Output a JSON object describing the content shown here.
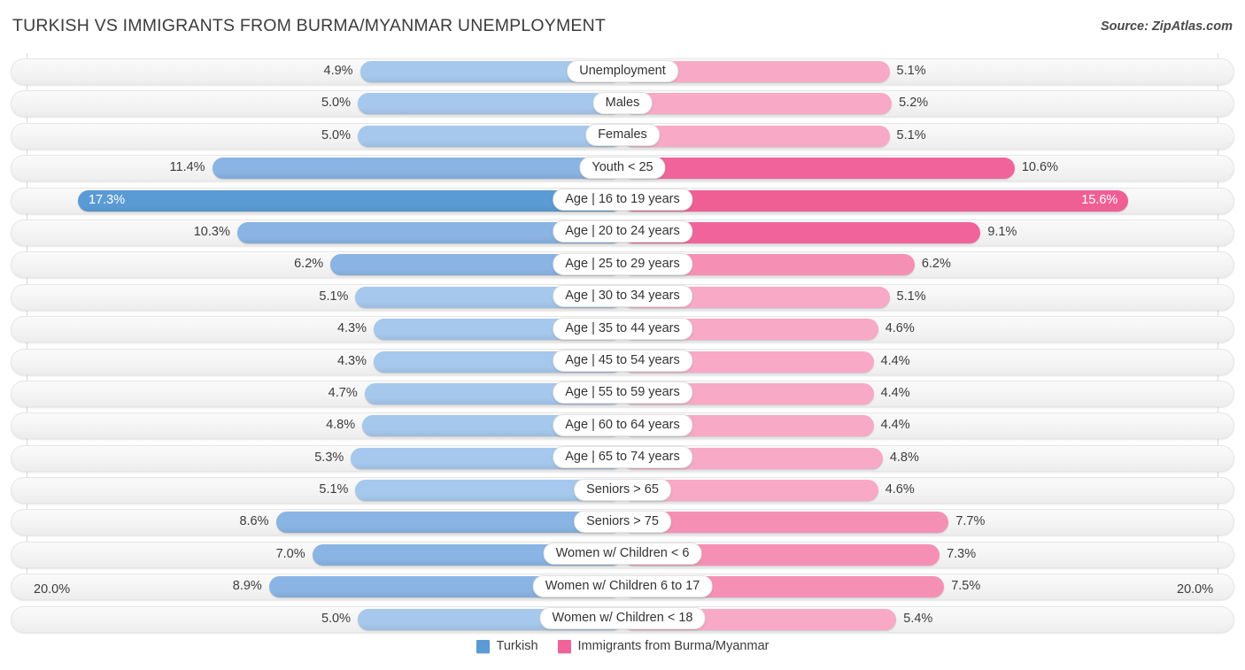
{
  "header": {
    "title": "TURKISH VS IMMIGRANTS FROM BURMA/MYANMAR UNEMPLOYMENT",
    "source": "Source: ZipAtlas.com"
  },
  "axis": {
    "left_label": "20.0%",
    "right_label": "20.0%"
  },
  "legend": {
    "items": [
      {
        "label": "Turkish",
        "color": "#5b9bd5"
      },
      {
        "label": "Immigrants from Burma/Myanmar",
        "color": "#f0649b"
      }
    ]
  },
  "colors": {
    "blue_light": "#a6c8ec",
    "blue_mid": "#8ab4e3",
    "blue_dark": "#5b9bd5",
    "pink_light": "#f7a9c5",
    "pink_mid": "#f590b4",
    "pink_dark": "#f0649b",
    "pink_darkest": "#ef5f94"
  },
  "chart_data": {
    "type": "bar",
    "title": "TURKISH VS IMMIGRANTS FROM BURMA/MYANMAR UNEMPLOYMENT",
    "orientation": "horizontal-diverging",
    "xlabel": "",
    "ylabel": "",
    "xlim": [
      20.0,
      20.0
    ],
    "axis_max": 20.0,
    "unit": "%",
    "grid": true,
    "legend_position": "bottom-center",
    "categories": [
      "Unemployment",
      "Males",
      "Females",
      "Youth < 25",
      "Age | 16 to 19 years",
      "Age | 20 to 24 years",
      "Age | 25 to 29 years",
      "Age | 30 to 34 years",
      "Age | 35 to 44 years",
      "Age | 45 to 54 years",
      "Age | 55 to 59 years",
      "Age | 60 to 64 years",
      "Age | 65 to 74 years",
      "Seniors > 65",
      "Seniors > 75",
      "Women w/ Children < 6",
      "Women w/ Children 6 to 17",
      "Women w/ Children < 18"
    ],
    "series": [
      {
        "name": "Turkish",
        "side": "left",
        "values": [
          4.9,
          5.0,
          5.0,
          11.4,
          17.3,
          10.3,
          6.2,
          5.1,
          4.3,
          4.3,
          4.7,
          4.8,
          5.3,
          5.1,
          8.6,
          7.0,
          8.9,
          5.0
        ],
        "labels": [
          "4.9%",
          "5.0%",
          "5.0%",
          "11.4%",
          "17.3%",
          "10.3%",
          "6.2%",
          "5.1%",
          "4.3%",
          "4.3%",
          "4.7%",
          "4.8%",
          "5.3%",
          "5.1%",
          "8.6%",
          "7.0%",
          "8.9%",
          "5.0%"
        ]
      },
      {
        "name": "Immigrants from Burma/Myanmar",
        "side": "right",
        "values": [
          5.1,
          5.2,
          5.1,
          10.6,
          15.6,
          9.1,
          6.2,
          5.1,
          4.6,
          4.4,
          4.4,
          4.4,
          4.8,
          4.6,
          7.7,
          7.3,
          7.5,
          5.4
        ],
        "labels": [
          "5.1%",
          "5.2%",
          "5.1%",
          "10.6%",
          "15.6%",
          "9.1%",
          "6.2%",
          "5.1%",
          "4.6%",
          "4.4%",
          "4.4%",
          "4.4%",
          "4.8%",
          "4.6%",
          "7.7%",
          "7.3%",
          "7.5%",
          "5.4%"
        ]
      }
    ]
  }
}
